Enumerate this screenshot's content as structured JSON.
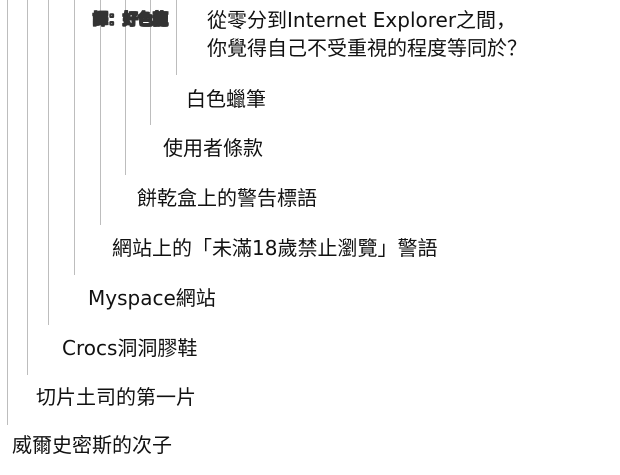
{
  "credit": "譯：好色龍",
  "question": {
    "line1": "從零分到Internet Explorer之間，",
    "line2": "你覺得自己不受重視的程度等同於？"
  },
  "answers": [
    "白色蠟筆",
    "使用者條款",
    "餅乾盒上的警告標語",
    "網站上的「未滿18歲禁止瀏覽」警語",
    "Myspace網站",
    "Crocs洞洞膠鞋",
    "切片土司的第一片",
    "威爾史密斯的次子"
  ]
}
